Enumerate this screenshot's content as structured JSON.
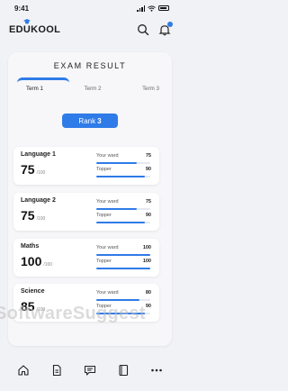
{
  "status_bar": {
    "time": "9:41"
  },
  "header": {
    "logo": "EDUKOOL"
  },
  "main": {
    "title": "EXAM RESULT",
    "tabs": [
      {
        "label": "Term 1",
        "active": true
      },
      {
        "label": "Term 2",
        "active": false
      },
      {
        "label": "Term 3",
        "active": false
      }
    ],
    "rank": {
      "label": "Rank",
      "value": "3"
    },
    "subjects": [
      {
        "name": "Language 1",
        "score": "75",
        "total": "/100",
        "ward_label": "Your ward",
        "ward_value": "75",
        "topper_label": "Topper",
        "topper_value": "90"
      },
      {
        "name": "Language 2",
        "score": "75",
        "total": "/100",
        "ward_label": "Your ward",
        "ward_value": "75",
        "topper_label": "Topper",
        "topper_value": "90"
      },
      {
        "name": "Maths",
        "score": "100",
        "total": "/100",
        "ward_label": "Your ward",
        "ward_value": "100",
        "topper_label": "Topper",
        "topper_value": "100"
      },
      {
        "name": "Science",
        "score": "85",
        "total": "/100",
        "ward_label": "Your ward",
        "ward_value": "80",
        "topper_label": "Topper",
        "topper_value": "90"
      }
    ]
  },
  "watermark": "SoftwareSuggest",
  "bottom_nav": [
    {
      "icon": "home-icon"
    },
    {
      "icon": "document-icon"
    },
    {
      "icon": "message-icon"
    },
    {
      "icon": "book-icon"
    },
    {
      "icon": "more-icon"
    }
  ],
  "colors": {
    "accent": "#2f7be8",
    "background": "#f1f2f6"
  }
}
